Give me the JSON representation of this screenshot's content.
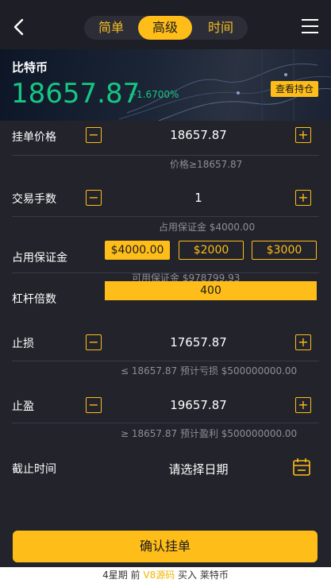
{
  "header": {
    "tabs": [
      {
        "label": "简单",
        "active": false
      },
      {
        "label": "高级",
        "active": true
      },
      {
        "label": "时间",
        "active": false
      }
    ]
  },
  "ticker": {
    "name": "比特币",
    "price": "18657.87",
    "change": "+1.6700%",
    "positions_label": "查看持仓"
  },
  "form": {
    "order_price": {
      "label": "挂单价格",
      "value": "18657.87",
      "hint": "价格≥18657.87"
    },
    "fee": {
      "label": "交易手数",
      "value": "1",
      "hint": "占用保证金 $4000.00"
    },
    "margin": {
      "label": "占用保证金",
      "options": [
        "$4000.00",
        "$2000",
        "$3000"
      ],
      "selected": "$4000.00",
      "hint": "可用保证金 $978799.93"
    },
    "leverage": {
      "label": "杠杆倍数",
      "value": "400"
    },
    "stop_loss": {
      "label": "止损",
      "value": "17657.87",
      "hint": "≤ 18657.87 预计亏损 $500000000.00"
    },
    "take_profit": {
      "label": "止盈",
      "value": "19657.87",
      "hint": "≥ 18657.87 预计盈利 $500000000.00"
    },
    "deadline": {
      "label": "截止时间",
      "placeholder": "请选择日期"
    }
  },
  "confirm_label": "确认挂单",
  "footer": {
    "prefix": "4星期 前",
    "brand": "V8源码",
    "action": "买入",
    "product": "莱特币"
  },
  "colors": {
    "accent": "#ffbd19",
    "up": "#16c784",
    "background": "#22232b"
  }
}
